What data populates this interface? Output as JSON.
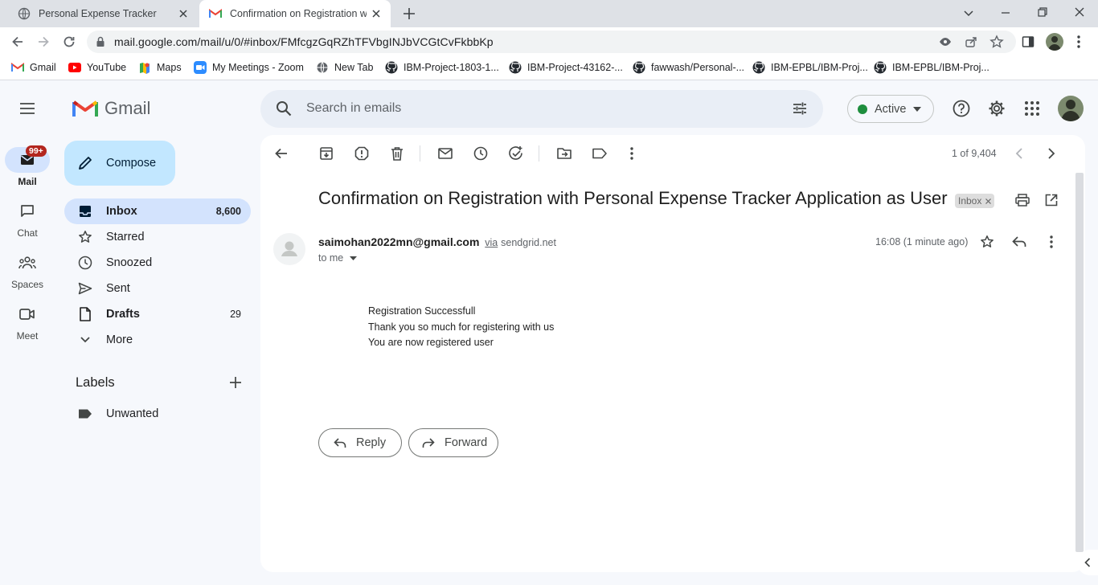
{
  "browser": {
    "tabs": [
      {
        "title": "Personal Expense Tracker",
        "icon": "globe-icon"
      },
      {
        "title": "Confirmation on Registration wit",
        "icon": "gmail-icon"
      }
    ],
    "url": "mail.google.com/mail/u/0/#inbox/FMfcgzGqRZhTFVbgINJbVCGtCvFkbbKp",
    "bookmarks": [
      {
        "label": "Gmail",
        "icon": "gmail-icon"
      },
      {
        "label": "YouTube",
        "icon": "youtube-icon"
      },
      {
        "label": "Maps",
        "icon": "maps-icon"
      },
      {
        "label": "My Meetings - Zoom",
        "icon": "zoom-icon"
      },
      {
        "label": "New Tab",
        "icon": "globe-icon"
      },
      {
        "label": "IBM-Project-1803-1...",
        "icon": "github-icon"
      },
      {
        "label": "IBM-Project-43162-...",
        "icon": "github-icon"
      },
      {
        "label": "fawwash/Personal-...",
        "icon": "github-icon"
      },
      {
        "label": "IBM-EPBL/IBM-Proj...",
        "icon": "github-icon"
      },
      {
        "label": "IBM-EPBL/IBM-Proj...",
        "icon": "github-icon"
      }
    ]
  },
  "gmail": {
    "logo_text": "Gmail",
    "search_placeholder": "Search in emails",
    "status": "Active",
    "rail": [
      {
        "label": "Mail",
        "badge": "99+"
      },
      {
        "label": "Chat"
      },
      {
        "label": "Spaces"
      },
      {
        "label": "Meet"
      }
    ],
    "compose_label": "Compose",
    "nav": [
      {
        "label": "Inbox",
        "count": "8,600"
      },
      {
        "label": "Starred",
        "count": ""
      },
      {
        "label": "Snoozed",
        "count": ""
      },
      {
        "label": "Sent",
        "count": ""
      },
      {
        "label": "Drafts",
        "count": "29"
      },
      {
        "label": "More",
        "count": ""
      }
    ],
    "labels_heading": "Labels",
    "labels": [
      {
        "label": "Unwanted"
      }
    ]
  },
  "message": {
    "pagination": "1 of 9,404",
    "subject": "Confirmation on Registration with Personal Expense Tracker Application as User",
    "chip": "Inbox",
    "sender": "saimohan2022mn@gmail.com",
    "via_label": "via",
    "via_domain": "sendgrid.net",
    "to": "to me",
    "time": "16:08 (1 minute ago)",
    "body": [
      "Registration Successfull",
      "Thank you so much for registering with us",
      "You are now registered user"
    ],
    "reply_label": "Reply",
    "forward_label": "Forward"
  },
  "colors": {
    "accent": "#0b57d0",
    "compose_bg": "#c2e7ff",
    "active_nav": "#d3e3fd",
    "status_dot": "#1e8e3e",
    "badge": "#b3261e"
  }
}
